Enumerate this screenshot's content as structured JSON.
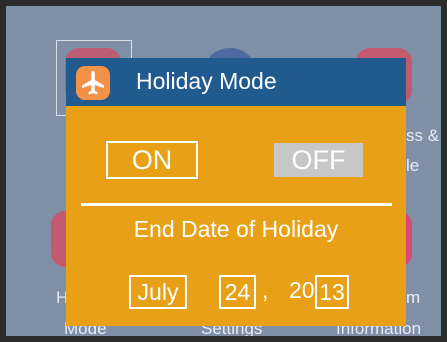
{
  "background": {
    "labels": {
      "left_top": "H",
      "left_bottom": "Mode",
      "center_bottom": "Settings",
      "right_top_1": "ss &",
      "right_top_2": "le",
      "right_mid": "m",
      "right_bottom": "Information"
    }
  },
  "dialog": {
    "title": "Holiday Mode",
    "icon": "airplane-icon",
    "toggle_on": "ON",
    "toggle_off": "OFF",
    "selected": "OFF",
    "end_date_label": "End Date of Holiday",
    "date": {
      "month": "July",
      "day": "24",
      "separator": ",",
      "year_prefix": "20",
      "year_suffix": "13"
    }
  },
  "colors": {
    "dialog_bg": "#e8a117",
    "header_bg": "#215a8f",
    "plane_badge": "#f39247",
    "off_button": "#c7c7c7"
  }
}
